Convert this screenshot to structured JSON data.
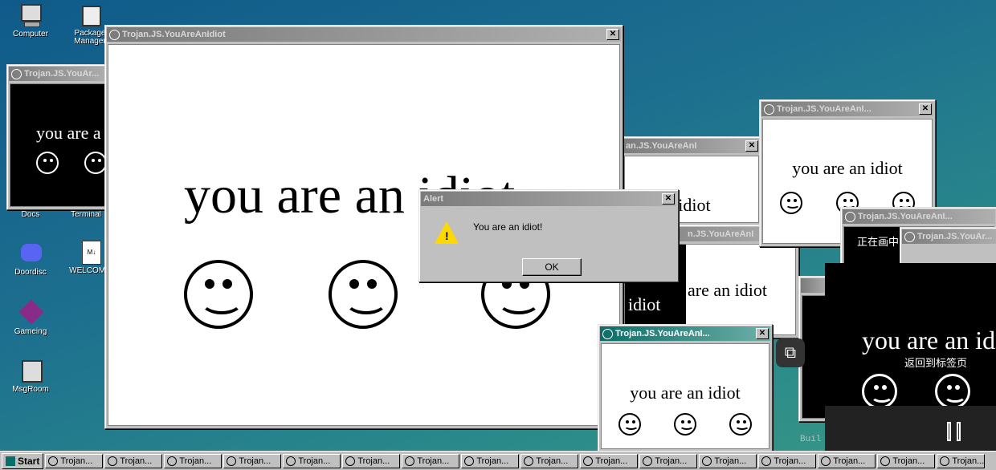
{
  "desktop": {
    "icons": [
      {
        "label": "Computer"
      },
      {
        "label": "Package Manager"
      },
      {
        "label": "Docs"
      },
      {
        "label": "Terminal"
      },
      {
        "label": "Doordisc"
      },
      {
        "label": "WELCOME"
      },
      {
        "label": "Gameing"
      },
      {
        "label": "MsgRoom"
      }
    ]
  },
  "window_title": "Trojan.JS.YouAreAnIdiot",
  "window_title_short": "Trojan.JS.YouAreAnI...",
  "window_title_partial": "Trojan.JS.YouAr...",
  "window_title_mid": "an.JS.YouAreAnI",
  "window_title_mid2": "n.JS.YouAreAnI",
  "message": "you are an idiot",
  "message_partial": "you are a",
  "message_cut": "you are an",
  "message_idiot": "idiot",
  "message_an_idiot": "an idiot",
  "message_are_an_idiot": "are an idiot",
  "alert": {
    "title": "Alert",
    "text": "You are an idiot!",
    "ok_label": "OK"
  },
  "overlay": {
    "title_cn": "正在画中",
    "return_cn": "返回到标签页",
    "build_text": "Buil"
  },
  "taskbar": {
    "start_label": "Start",
    "button_label": "Trojan..."
  },
  "colors": {
    "desktop": "#1d6f8f",
    "titlebar_inactive": "#808080",
    "titlebar_active": "#0a6e68",
    "window": "#c0c0c0"
  }
}
